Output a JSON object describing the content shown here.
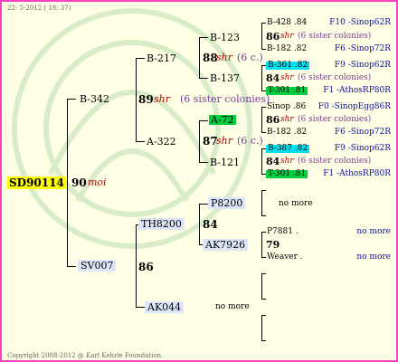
{
  "header": {
    "date": "22-  5-2012 ( 18: 37)"
  },
  "footer": {
    "copyright": "Copyright 2008-2012 @ Karl Kehrle Foundation."
  },
  "root": {
    "id": "SD90114",
    "gen": "90",
    "gen_suffix": "moi"
  },
  "colors": {
    "border": "#ff40c0",
    "root_bg": "#ffff00",
    "cyan_box": "#00e0f0",
    "green_box": "#00d040",
    "id_box": "#dde6f8"
  },
  "gen1": {
    "father": {
      "id": "B-342",
      "gen": "89",
      "gen_suffix": "shr",
      "note": "(6 sister colonies)"
    },
    "mother": {
      "id": "SV007",
      "gen": "86"
    }
  },
  "gen2": {
    "ff": {
      "id": "B-217",
      "gen": "88",
      "gen_suffix": "shr",
      "note": "(6 c.)"
    },
    "fm": {
      "id": "A-322",
      "gen": "87",
      "gen_suffix": "shr",
      "note": "(6 c.)"
    },
    "mf": {
      "id": "TH8200",
      "gen": "84"
    },
    "mm": {
      "id": "AK044",
      "note": "no more"
    }
  },
  "gen3": {
    "fff": {
      "id": "B-123"
    },
    "ffm": {
      "id": "B-137"
    },
    "fmf": {
      "id": "A-72"
    },
    "fmm": {
      "id": "B-121"
    },
    "mff": {
      "id": "P8200",
      "note": "no more"
    },
    "mfm": {
      "id": "AK7926",
      "gen": "79"
    }
  },
  "gen4": [
    {
      "id": "B-428 .84",
      "right": "F10 -Sinop62R"
    },
    {
      "gen": "86",
      "gen_suffix": "shr",
      "note": "(6 sister colonies)"
    },
    {
      "id": "B-182 .82",
      "right": "F6 -Sinop72R"
    },
    {
      "id": "B-361 .82",
      "right": "F9 -Sinop62R"
    },
    {
      "gen": "84",
      "gen_suffix": "shr",
      "note": "(6 sister colonies)"
    },
    {
      "id": "T-301 .81",
      "right": "F1 -AthosRP80R"
    },
    {
      "id": "Sinop .86",
      "right": "F0 -SinopEgg86R"
    },
    {
      "gen": "86",
      "gen_suffix": "shr",
      "note": "(6 sister colonies)"
    },
    {
      "id": "B-182 .82",
      "right": "F6 -Sinop72R"
    },
    {
      "id": "B-387 .82",
      "right": "F9 -Sinop62R"
    },
    {
      "gen": "84",
      "gen_suffix": "shr",
      "note": "(6 sister colonies)"
    },
    {
      "id": "T-301 .81",
      "right": "F1 -AthosRP80R"
    },
    {
      "note": "no more"
    },
    {
      "id": "P7881 .",
      "right": "no more"
    },
    {
      "gen": "79"
    },
    {
      "id": "Weaver .",
      "right": "no more"
    }
  ]
}
